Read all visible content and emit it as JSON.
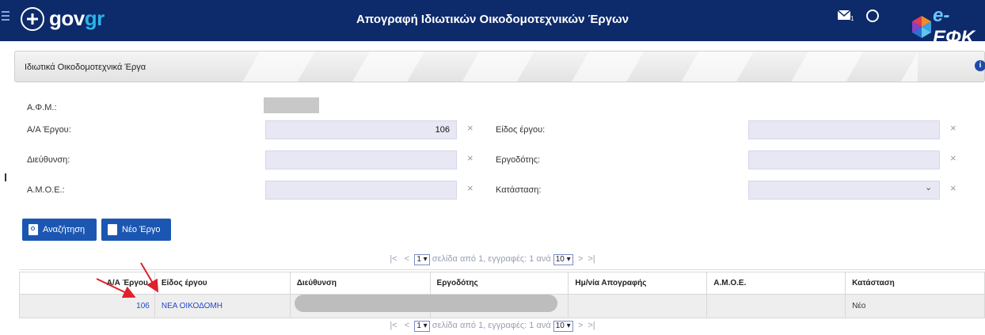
{
  "header": {
    "logo_text_main": "gov",
    "logo_text_accent": "gr",
    "title": "Απογραφή Ιδιωτικών Οικοδομοτεχνικών Έργων",
    "mail_badge": "1",
    "efk_prefix": "e-",
    "efk_text": "ΕΦΚ"
  },
  "card": {
    "title": "Ιδιωτικά Οικοδομοτεχνικά Έργα",
    "info_glyph": "i"
  },
  "form": {
    "afm_label": "Α.Φ.Μ.:",
    "aa_label": "Α/Α Έργου:",
    "aa_value": "106",
    "address_label": "Διεύθυνση:",
    "amoe_label": "Α.Μ.Ο.Ε.:",
    "type_label": "Είδος έργου:",
    "employer_label": "Εργοδότης:",
    "status_label": "Κατάσταση:",
    "clear_glyph": "×",
    "chevron_glyph": "⌄"
  },
  "buttons": {
    "search": "Αναζήτηση",
    "new_project": "Νέο Έργο"
  },
  "pager": {
    "first": "|<",
    "prev": "<",
    "page": "1",
    "text": "σελίδα από 1, εγγραφές: 1 ανά",
    "per_page": "10",
    "next": ">",
    "last": ">|"
  },
  "table": {
    "headers": [
      "Α/Α Έργου",
      "Είδος έργου",
      "Διεύθυνση",
      "Εργοδότης",
      "Ημ/νία Απογραφής",
      "Α.Μ.Ο.Ε.",
      "Κατάσταση"
    ],
    "rows": [
      {
        "aa": "106",
        "type": "ΝΕΑ ΟΙΚΟΔΟΜΗ",
        "address": "",
        "employer": "",
        "date": "",
        "amoe": "",
        "status": "Νέο"
      }
    ]
  },
  "colors": {
    "header_bg": "#0d2a6b",
    "button_bg": "#1b57b2",
    "link": "#2448c8",
    "arrow": "#e0202a"
  }
}
